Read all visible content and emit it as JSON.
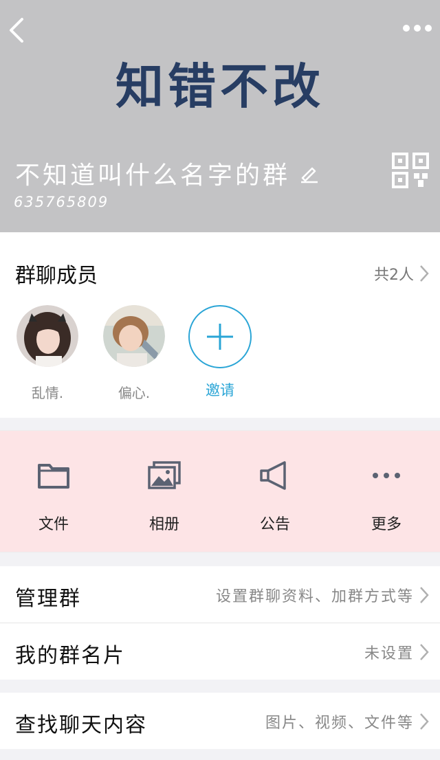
{
  "header": {
    "banner_text": "知错不改",
    "group_name": "不知道叫什么名字的群",
    "group_id": "635765809"
  },
  "members": {
    "title": "群聊成员",
    "count": "共2人",
    "list": [
      {
        "name": "乱情."
      },
      {
        "name": "偏心."
      }
    ],
    "invite_label": "邀请"
  },
  "actions": [
    {
      "label": "文件",
      "icon": "folder-icon"
    },
    {
      "label": "相册",
      "icon": "album-icon"
    },
    {
      "label": "公告",
      "icon": "megaphone-icon"
    },
    {
      "label": "更多",
      "icon": "more-dots-icon"
    }
  ],
  "rows": {
    "manage": {
      "title": "管理群",
      "hint": "设置群聊资料、加群方式等"
    },
    "card": {
      "title": "我的群名片",
      "hint": "未设置"
    },
    "search": {
      "title": "查找聊天内容",
      "hint": "图片、视频、文件等"
    }
  },
  "colors": {
    "header_bg": "#c3c3c5",
    "banner_text": "#273d63",
    "accent_blue": "#2aa5d6",
    "actions_bg": "#fde4e6",
    "icon_gray": "#5b6272"
  }
}
